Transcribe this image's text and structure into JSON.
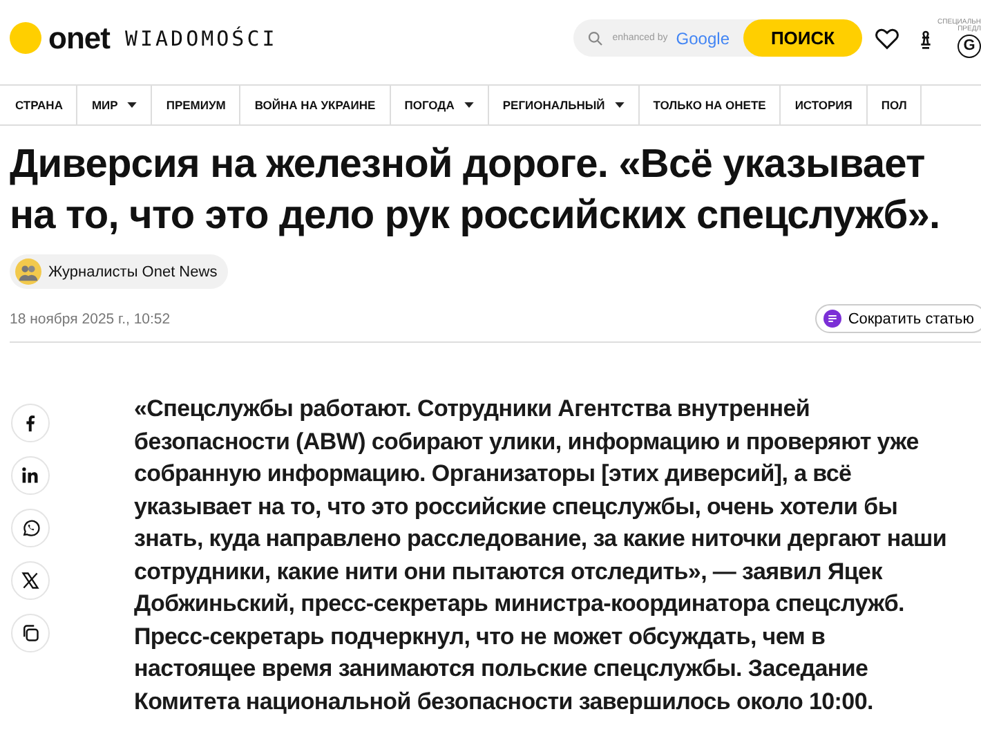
{
  "header": {
    "logo": "onet",
    "section": "WIADOMOŚCI",
    "search_hint": "enhanced by",
    "search_brand": "Google",
    "search_button": "ПОИСК",
    "promo_lines": [
      "СПЕЦИАЛЬН",
      "ПРЕДЛ"
    ],
    "promo_badge": "G"
  },
  "nav": [
    {
      "label": "СТРАНА",
      "dropdown": false
    },
    {
      "label": "МИР",
      "dropdown": true
    },
    {
      "label": "ПРЕМИУМ",
      "dropdown": false
    },
    {
      "label": "ВОЙНА НА УКРАИНЕ",
      "dropdown": false
    },
    {
      "label": "ПОГОДА",
      "dropdown": true
    },
    {
      "label": "РЕГИОНАЛЬНЫЙ",
      "dropdown": true
    },
    {
      "label": "ТОЛЬКО НА ОНЕТЕ",
      "dropdown": false
    },
    {
      "label": "ИСТОРИЯ",
      "dropdown": false
    },
    {
      "label": "ПОЛ",
      "dropdown": false
    }
  ],
  "article": {
    "title": "Диверсия на железной дороге. «Всё указывает на то, что это дело рук российских спецслужб».",
    "author": "Журналисты Onet News",
    "date": "18 ноября 2025 г., 10:52",
    "summary_button": "Сократить статью",
    "body": "«Спецслужбы работают. Сотрудники Агентства внутренней безопасности (ABW) собирают улики, информацию и проверяют уже собранную информацию. Организаторы [этих диверсий], а всё указывает на то, что это российские спецслужбы, очень хотели бы знать, куда направлено расследование, за какие ниточки дергают наши сотрудники, какие нити они пытаются отследить», — заявил Яцек Добжиньский, пресс-секретарь министра-координатора спецслужб. Пресс-секретарь подчеркнул, что не может обсуждать, чем в настоящее время занимаются польские спецслужбы. Заседание Комитета национальной безопасности завершилось около 10:00."
  },
  "share": [
    {
      "kind": "facebook"
    },
    {
      "kind": "linkedin"
    },
    {
      "kind": "whatsapp"
    },
    {
      "kind": "x"
    },
    {
      "kind": "copy"
    }
  ]
}
